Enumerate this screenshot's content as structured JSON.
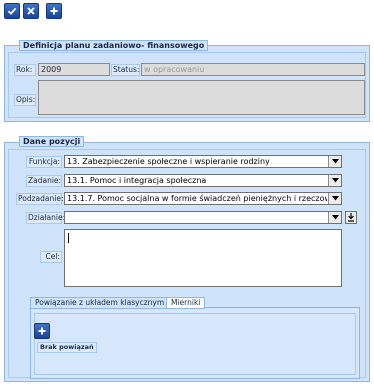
{
  "toolbar": {
    "confirm_icon": "check-icon",
    "cancel_icon": "close-icon",
    "add_icon": "plus-icon"
  },
  "plan": {
    "legend": "Definicja planu zadaniowo- finansowego",
    "rok_label": "Rok:",
    "rok_value": "2009",
    "status_label": "Status:",
    "status_value": "w opracowaniu",
    "opis_label": "Opis:",
    "opis_value": ""
  },
  "position": {
    "legend": "Dane pozycji",
    "funkcja_label": "Funkcja:",
    "funkcja_value": "13. Zabezpieczenie społeczne i wspieranie rodziny",
    "zadanie_label": "Zadanie:",
    "zadanie_value": "13.1. Pomoc i integracja społeczna",
    "podzadanie_label": "Podzadanie:",
    "podzadanie_value": "13.1.7. Pomoc socjalna w formie świadczeń pieniężnych i rzeczow",
    "dzialanie_label": "Działanie:",
    "dzialanie_value": "",
    "cel_label": "Cel:",
    "cel_value": ""
  },
  "tabs": [
    {
      "label": "Powiązanie z układem klasycznym",
      "active": true
    },
    {
      "label": "Mierniki",
      "active": false
    }
  ],
  "links": {
    "empty_label": "Brak powiązań"
  },
  "colors": {
    "accent": "#1b4593",
    "panel": "#cfe3fb",
    "border": "#8fb6e6"
  }
}
